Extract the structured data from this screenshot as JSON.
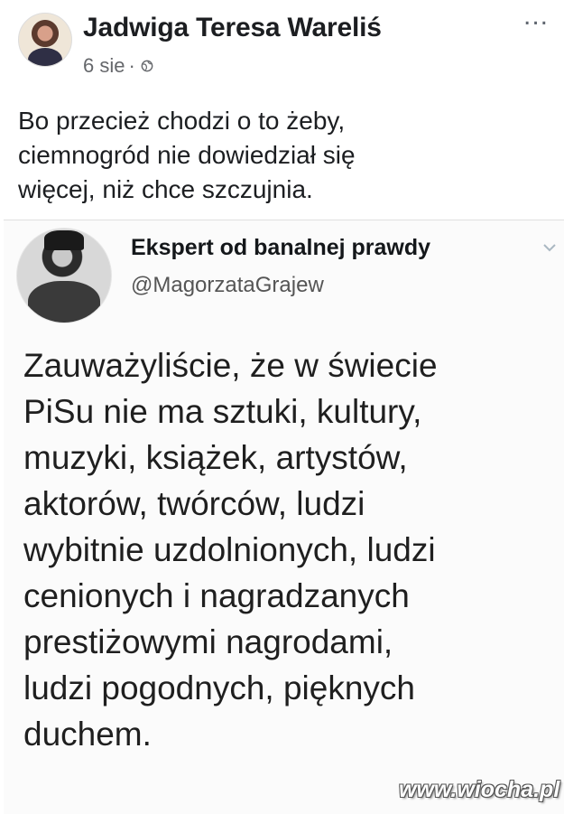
{
  "post": {
    "author": "Jadwiga Teresa Wareliś",
    "time": "6 sie",
    "separator": "·",
    "privacy_icon": "globe-icon",
    "more_icon": "...",
    "text_lines": [
      "Bo przecież chodzi o to żeby,",
      "ciemnogród nie dowiedział się",
      "więcej, niż chce szczujnia."
    ]
  },
  "tweet": {
    "name": "Ekspert od banalnej prawdy",
    "handle": "@MagorzataGrajew",
    "body_lines": [
      "Zauważyliście, że w świecie",
      "PiSu nie ma sztuki, kultury,",
      "muzyki, książek, artystów,",
      "aktorów, twórców, ludzi",
      "wybitnie uzdolnionych, ludzi",
      "cenionych i nagradzanych",
      "prestiżowymi nagrodami,",
      "ludzi pogodnych, pięknych",
      "duchem."
    ]
  },
  "watermark": "www.wiocha.pl"
}
